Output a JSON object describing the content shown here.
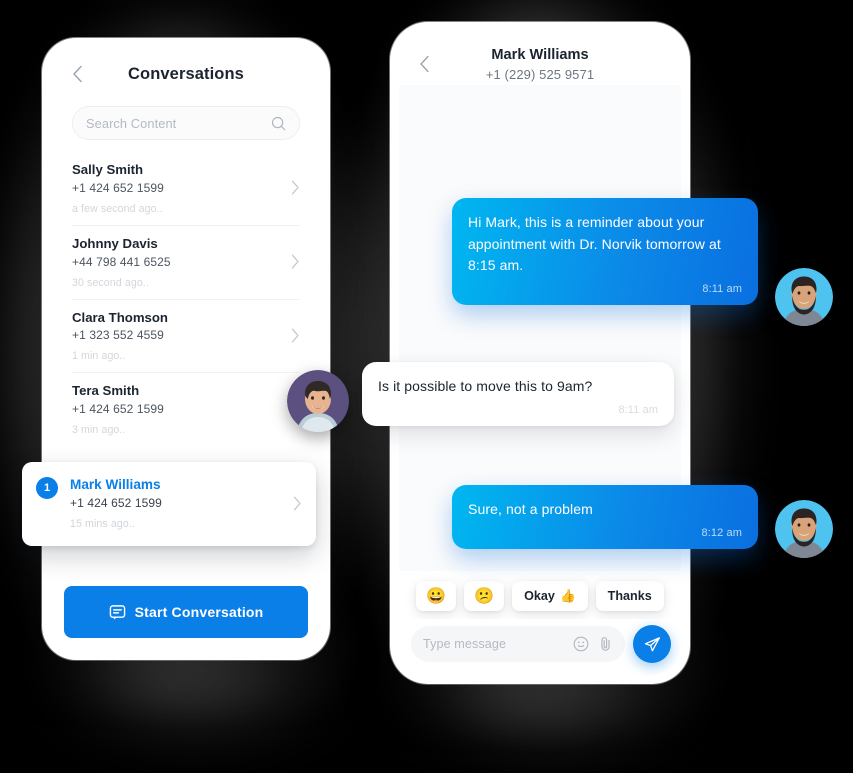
{
  "theme": {
    "background": "#000000",
    "accent": "#0b7fe8",
    "bubble_gradient_start": "#00b7f0",
    "bubble_gradient_end": "#0a6fe0",
    "text_primary": "#1b2430",
    "text_muted": "#6e7682",
    "text_faint": "#d2d6dc"
  },
  "left_phone": {
    "header": {
      "back_icon": "chevron-left-icon",
      "title": "Conversations"
    },
    "search": {
      "placeholder": "Search Content",
      "icon": "search-icon"
    },
    "conversations": [
      {
        "name": "Sally Smith",
        "phone": "+1 424 652 1599",
        "time": "a few second ago..",
        "badge": ""
      },
      {
        "name": "Johnny Davis",
        "phone": "+44 798 441 6525",
        "time": "30 second ago..",
        "badge": ""
      },
      {
        "name": "Clara Thomson",
        "phone": "+1 323 552 4559",
        "time": "1 min ago..",
        "badge": ""
      },
      {
        "name": "Tera Smith",
        "phone": "+1 424 652 1599",
        "time": "3 min ago..",
        "badge": ""
      }
    ],
    "highlighted_conversation": {
      "badge": "1",
      "name": "Mark Williams",
      "phone": "+1 424 652 1599",
      "time": "15 mins ago..",
      "arrow_icon": "chevron-right-icon"
    },
    "start_button": {
      "label": "Start Conversation",
      "icon": "chat-bubble-icon"
    },
    "floating_avatar": {
      "name": "avatar-smiling-man",
      "background": "#5b5080"
    }
  },
  "right_phone": {
    "header": {
      "back_icon": "chevron-left-icon",
      "name": "Mark Williams",
      "number": "+1 (229) 525 9571"
    },
    "messages": [
      {
        "direction": "outgoing",
        "text": "Hi Mark, this is a reminder about your appointment with Dr. Norvik tomorrow at  8:15 am.",
        "time": "8:11 am",
        "avatar": "avatar-bearded-man"
      },
      {
        "direction": "incoming",
        "text": "Is it possible to move this to 9am?",
        "time": "8:11 am",
        "avatar": ""
      },
      {
        "direction": "outgoing",
        "text": "Sure, not a problem",
        "time": "8:12 am",
        "avatar": "avatar-bearded-man"
      }
    ],
    "quick_replies": [
      {
        "emoji": "😀",
        "label": ""
      },
      {
        "emoji": "😕",
        "label": ""
      },
      {
        "emoji": "👍",
        "label": "Okay"
      },
      {
        "emoji": "",
        "label": "Thanks"
      }
    ],
    "input_bar": {
      "placeholder": "Type message",
      "emoji_icon": "smiley-icon",
      "attach_icon": "paperclip-icon",
      "send_icon": "send-paper-plane-icon"
    },
    "avatar": {
      "name": "avatar-bearded-man",
      "background": "#4fc3f0"
    }
  }
}
